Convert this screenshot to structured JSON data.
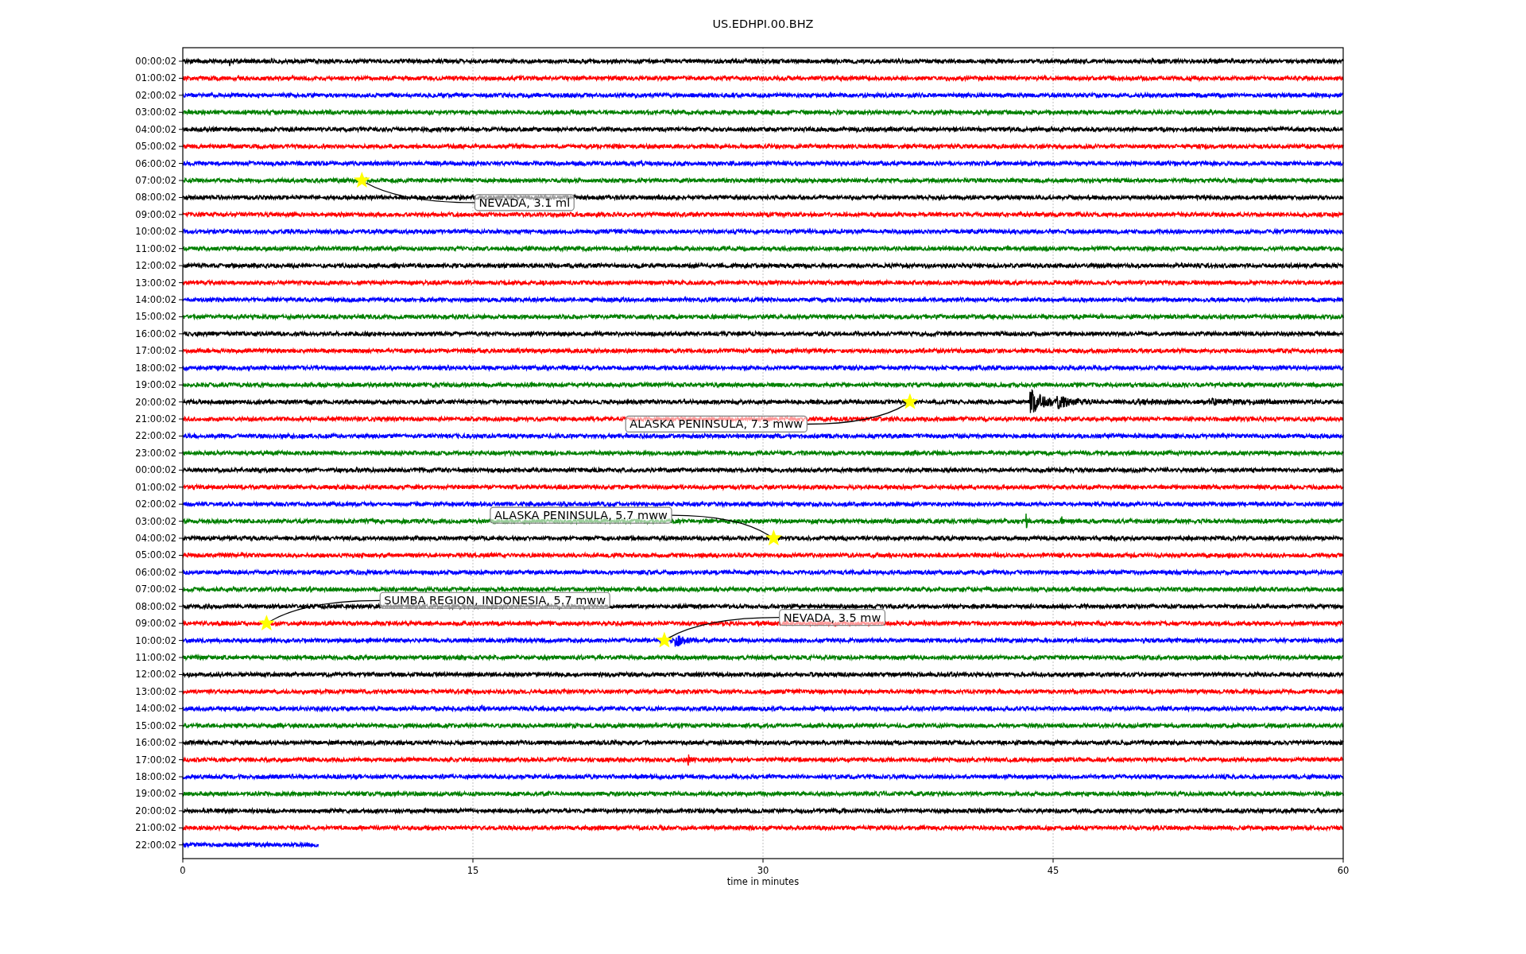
{
  "plot": {
    "title": "US.EDHPI.00.BHZ",
    "x_label": "time in minutes",
    "x_ticks": [
      "0",
      "15",
      "30",
      "45",
      "60"
    ],
    "rows": [
      {
        "label": "00:00:02",
        "color": "#000000",
        "level": 1
      },
      {
        "label": "01:00:02",
        "color": "#ff0000",
        "level": 1
      },
      {
        "label": "02:00:02",
        "color": "#0000ff",
        "level": 1
      },
      {
        "label": "03:00:02",
        "color": "#008000",
        "level": 1
      },
      {
        "label": "04:00:02",
        "color": "#000000",
        "level": 1
      },
      {
        "label": "05:00:02",
        "color": "#ff0000",
        "level": 1
      },
      {
        "label": "06:00:02",
        "color": "#0000ff",
        "level": 1
      },
      {
        "label": "07:00:02",
        "color": "#008000",
        "level": 1
      },
      {
        "label": "08:00:02",
        "color": "#000000",
        "level": 1
      },
      {
        "label": "09:00:02",
        "color": "#ff0000",
        "level": 1
      },
      {
        "label": "10:00:02",
        "color": "#0000ff",
        "level": 1
      },
      {
        "label": "11:00:02",
        "color": "#008000",
        "level": 1
      },
      {
        "label": "12:00:02",
        "color": "#000000",
        "level": 1
      },
      {
        "label": "13:00:02",
        "color": "#ff0000",
        "level": 1
      },
      {
        "label": "14:00:02",
        "color": "#0000ff",
        "level": 1
      },
      {
        "label": "15:00:02",
        "color": "#008000",
        "level": 1
      },
      {
        "label": "16:00:02",
        "color": "#000000",
        "level": 1
      },
      {
        "label": "17:00:02",
        "color": "#ff0000",
        "level": 1
      },
      {
        "label": "18:00:02",
        "color": "#0000ff",
        "level": 1
      },
      {
        "label": "19:00:02",
        "color": "#008000",
        "level": 1
      },
      {
        "label": "20:00:02",
        "color": "#000000",
        "level": 1
      },
      {
        "label": "21:00:02",
        "color": "#ff0000",
        "level": 1
      },
      {
        "label": "22:00:02",
        "color": "#0000ff",
        "level": 1
      },
      {
        "label": "23:00:02",
        "color": "#008000",
        "level": 1
      },
      {
        "label": "00:00:02",
        "color": "#000000",
        "level": 1
      },
      {
        "label": "01:00:02",
        "color": "#ff0000",
        "level": 1
      },
      {
        "label": "02:00:02",
        "color": "#0000ff",
        "level": 1
      },
      {
        "label": "03:00:02",
        "color": "#008000",
        "level": 1
      },
      {
        "label": "04:00:02",
        "color": "#000000",
        "level": 1
      },
      {
        "label": "05:00:02",
        "color": "#ff0000",
        "level": 1
      },
      {
        "label": "06:00:02",
        "color": "#0000ff",
        "level": 1
      },
      {
        "label": "07:00:02",
        "color": "#008000",
        "level": 1
      },
      {
        "label": "08:00:02",
        "color": "#000000",
        "level": 1
      },
      {
        "label": "09:00:02",
        "color": "#ff0000",
        "level": 1
      },
      {
        "label": "10:00:02",
        "color": "#0000ff",
        "level": 1
      },
      {
        "label": "11:00:02",
        "color": "#008000",
        "level": 1
      },
      {
        "label": "12:00:02",
        "color": "#000000",
        "level": 1
      },
      {
        "label": "13:00:02",
        "color": "#ff0000",
        "level": 1
      },
      {
        "label": "14:00:02",
        "color": "#0000ff",
        "level": 1
      },
      {
        "label": "15:00:02",
        "color": "#008000",
        "level": 1
      },
      {
        "label": "16:00:02",
        "color": "#000000",
        "level": 1
      },
      {
        "label": "17:00:02",
        "color": "#ff0000",
        "level": 1
      },
      {
        "label": "18:00:02",
        "color": "#0000ff",
        "level": 1
      },
      {
        "label": "19:00:02",
        "color": "#008000",
        "level": 1
      },
      {
        "label": "20:00:02",
        "color": "#000000",
        "level": 1
      },
      {
        "label": "21:00:02",
        "color": "#ff0000",
        "level": 1
      },
      {
        "label": "22:00:02",
        "color": "#0000ff",
        "level": 0.117
      }
    ],
    "events": [
      {
        "text": "NEVADA, 3.1 ml"
      },
      {
        "text": "ALASKA PENINSULA, 7.3 mww"
      },
      {
        "text": "ALASKA PENINSULA, 5.7 mww"
      },
      {
        "text": "SUMBA REGION, INDONESIA, 5.7 mww"
      },
      {
        "text": "NEVADA, 3.5 mw"
      }
    ]
  }
}
